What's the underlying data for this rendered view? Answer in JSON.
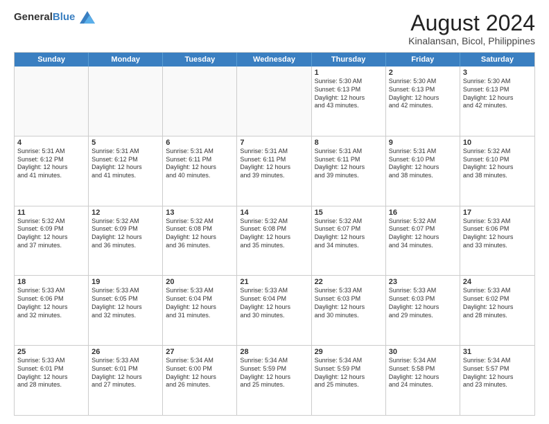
{
  "logo": {
    "general": "General",
    "blue": "Blue"
  },
  "title": "August 2024",
  "subtitle": "Kinalansan, Bicol, Philippines",
  "headers": [
    "Sunday",
    "Monday",
    "Tuesday",
    "Wednesday",
    "Thursday",
    "Friday",
    "Saturday"
  ],
  "weeks": [
    [
      {
        "day": "",
        "text": "",
        "empty": true
      },
      {
        "day": "",
        "text": "",
        "empty": true
      },
      {
        "day": "",
        "text": "",
        "empty": true
      },
      {
        "day": "",
        "text": "",
        "empty": true
      },
      {
        "day": "1",
        "text": "Sunrise: 5:30 AM\nSunset: 6:13 PM\nDaylight: 12 hours\nand 43 minutes."
      },
      {
        "day": "2",
        "text": "Sunrise: 5:30 AM\nSunset: 6:13 PM\nDaylight: 12 hours\nand 42 minutes."
      },
      {
        "day": "3",
        "text": "Sunrise: 5:30 AM\nSunset: 6:13 PM\nDaylight: 12 hours\nand 42 minutes."
      }
    ],
    [
      {
        "day": "4",
        "text": "Sunrise: 5:31 AM\nSunset: 6:12 PM\nDaylight: 12 hours\nand 41 minutes."
      },
      {
        "day": "5",
        "text": "Sunrise: 5:31 AM\nSunset: 6:12 PM\nDaylight: 12 hours\nand 41 minutes."
      },
      {
        "day": "6",
        "text": "Sunrise: 5:31 AM\nSunset: 6:11 PM\nDaylight: 12 hours\nand 40 minutes."
      },
      {
        "day": "7",
        "text": "Sunrise: 5:31 AM\nSunset: 6:11 PM\nDaylight: 12 hours\nand 39 minutes."
      },
      {
        "day": "8",
        "text": "Sunrise: 5:31 AM\nSunset: 6:11 PM\nDaylight: 12 hours\nand 39 minutes."
      },
      {
        "day": "9",
        "text": "Sunrise: 5:31 AM\nSunset: 6:10 PM\nDaylight: 12 hours\nand 38 minutes."
      },
      {
        "day": "10",
        "text": "Sunrise: 5:32 AM\nSunset: 6:10 PM\nDaylight: 12 hours\nand 38 minutes."
      }
    ],
    [
      {
        "day": "11",
        "text": "Sunrise: 5:32 AM\nSunset: 6:09 PM\nDaylight: 12 hours\nand 37 minutes."
      },
      {
        "day": "12",
        "text": "Sunrise: 5:32 AM\nSunset: 6:09 PM\nDaylight: 12 hours\nand 36 minutes."
      },
      {
        "day": "13",
        "text": "Sunrise: 5:32 AM\nSunset: 6:08 PM\nDaylight: 12 hours\nand 36 minutes."
      },
      {
        "day": "14",
        "text": "Sunrise: 5:32 AM\nSunset: 6:08 PM\nDaylight: 12 hours\nand 35 minutes."
      },
      {
        "day": "15",
        "text": "Sunrise: 5:32 AM\nSunset: 6:07 PM\nDaylight: 12 hours\nand 34 minutes."
      },
      {
        "day": "16",
        "text": "Sunrise: 5:32 AM\nSunset: 6:07 PM\nDaylight: 12 hours\nand 34 minutes."
      },
      {
        "day": "17",
        "text": "Sunrise: 5:33 AM\nSunset: 6:06 PM\nDaylight: 12 hours\nand 33 minutes."
      }
    ],
    [
      {
        "day": "18",
        "text": "Sunrise: 5:33 AM\nSunset: 6:06 PM\nDaylight: 12 hours\nand 32 minutes."
      },
      {
        "day": "19",
        "text": "Sunrise: 5:33 AM\nSunset: 6:05 PM\nDaylight: 12 hours\nand 32 minutes."
      },
      {
        "day": "20",
        "text": "Sunrise: 5:33 AM\nSunset: 6:04 PM\nDaylight: 12 hours\nand 31 minutes."
      },
      {
        "day": "21",
        "text": "Sunrise: 5:33 AM\nSunset: 6:04 PM\nDaylight: 12 hours\nand 30 minutes."
      },
      {
        "day": "22",
        "text": "Sunrise: 5:33 AM\nSunset: 6:03 PM\nDaylight: 12 hours\nand 30 minutes."
      },
      {
        "day": "23",
        "text": "Sunrise: 5:33 AM\nSunset: 6:03 PM\nDaylight: 12 hours\nand 29 minutes."
      },
      {
        "day": "24",
        "text": "Sunrise: 5:33 AM\nSunset: 6:02 PM\nDaylight: 12 hours\nand 28 minutes."
      }
    ],
    [
      {
        "day": "25",
        "text": "Sunrise: 5:33 AM\nSunset: 6:01 PM\nDaylight: 12 hours\nand 28 minutes."
      },
      {
        "day": "26",
        "text": "Sunrise: 5:33 AM\nSunset: 6:01 PM\nDaylight: 12 hours\nand 27 minutes."
      },
      {
        "day": "27",
        "text": "Sunrise: 5:34 AM\nSunset: 6:00 PM\nDaylight: 12 hours\nand 26 minutes."
      },
      {
        "day": "28",
        "text": "Sunrise: 5:34 AM\nSunset: 5:59 PM\nDaylight: 12 hours\nand 25 minutes."
      },
      {
        "day": "29",
        "text": "Sunrise: 5:34 AM\nSunset: 5:59 PM\nDaylight: 12 hours\nand 25 minutes."
      },
      {
        "day": "30",
        "text": "Sunrise: 5:34 AM\nSunset: 5:58 PM\nDaylight: 12 hours\nand 24 minutes."
      },
      {
        "day": "31",
        "text": "Sunrise: 5:34 AM\nSunset: 5:57 PM\nDaylight: 12 hours\nand 23 minutes."
      }
    ]
  ]
}
